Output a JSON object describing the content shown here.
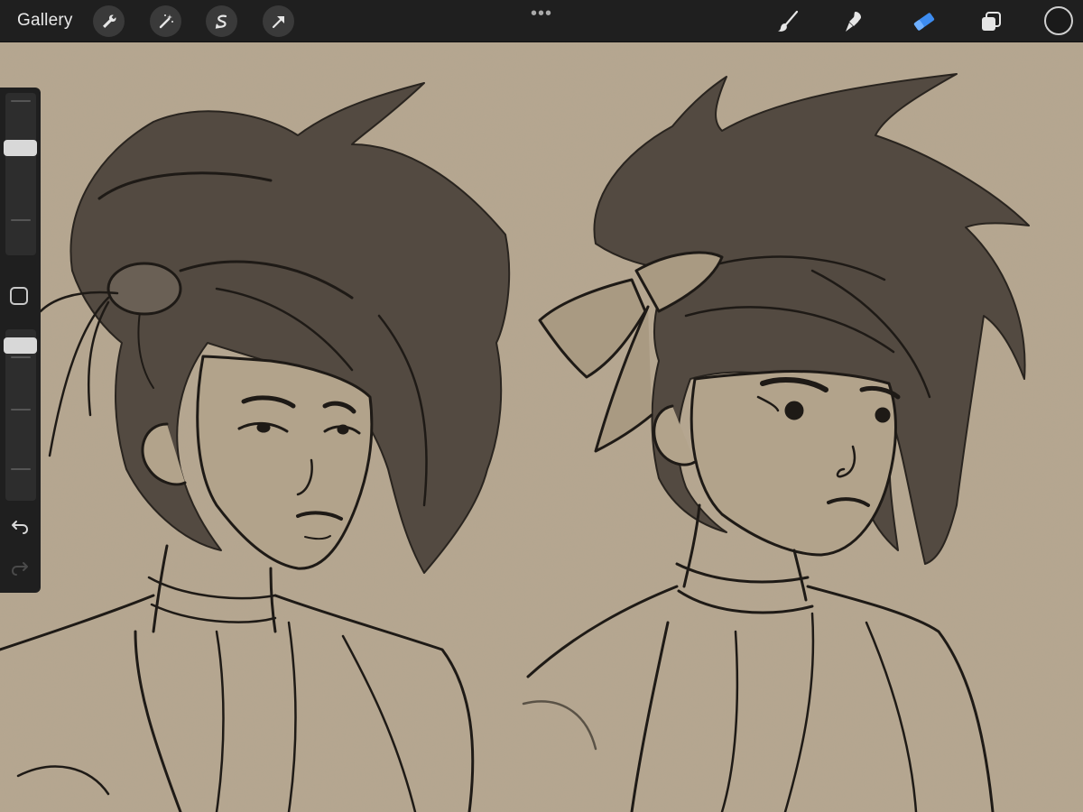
{
  "toolbar": {
    "gallery_label": "Gallery",
    "left_tools": [
      "wrench-icon",
      "magic-wand-icon",
      "selection-icon",
      "transform-arrow-icon"
    ],
    "more_label": "•••",
    "right_tools": [
      "brush-icon",
      "smudge-icon",
      "eraser-icon",
      "layers-icon"
    ],
    "active_tool": "eraser-icon",
    "active_color": "#1a1a1a",
    "accent_color": "#3d8cf0"
  },
  "sidebar": {
    "brush_size_fraction": 0.68,
    "opacity_fraction": 0.95,
    "modify_button": "square-modify-icon",
    "undo": "undo-icon",
    "redo": "redo-icon"
  },
  "canvas": {
    "paper_color": "#b5a68f",
    "ink_color": "#1e1a16"
  }
}
